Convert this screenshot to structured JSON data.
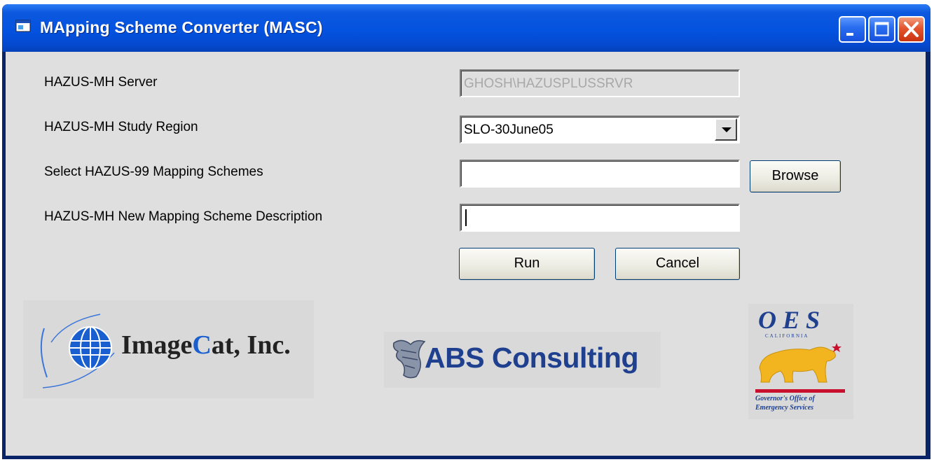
{
  "window": {
    "title": "MApping Scheme Converter (MASC)"
  },
  "titlebar_buttons": {
    "minimize": "minimize-icon",
    "maximize": "maximize-icon",
    "close": "close-icon"
  },
  "form": {
    "server_label": "HAZUS-MH Server",
    "server_value": "GHOSH\\HAZUSPLUSSRVR",
    "region_label": "HAZUS-MH Study Region",
    "region_value": "SLO-30June05",
    "schemes_label": "Select HAZUS-99 Mapping Schemes",
    "schemes_value": "",
    "description_label": "HAZUS-MH New Mapping Scheme Description",
    "description_value": ""
  },
  "buttons": {
    "browse": "Browse",
    "run": "Run",
    "cancel": "Cancel"
  },
  "logos": {
    "imagecat": {
      "name_prefix": "Image",
      "name_accent": "C",
      "name_suffix": "at, Inc."
    },
    "abs": {
      "name": "ABS Consulting"
    },
    "oes": {
      "acronym": "O E S",
      "state": "CALIFORNIA",
      "org_line1": "Governor's Office of",
      "org_line2": "Emergency Services"
    }
  },
  "colors": {
    "titlebar": "#0453e0",
    "client": "#dfdfdf",
    "abs_blue": "#1f3f8f",
    "imagecat_blue": "#1a5fd0",
    "oes_bear": "#f2b51f",
    "oes_red": "#c8102e"
  }
}
